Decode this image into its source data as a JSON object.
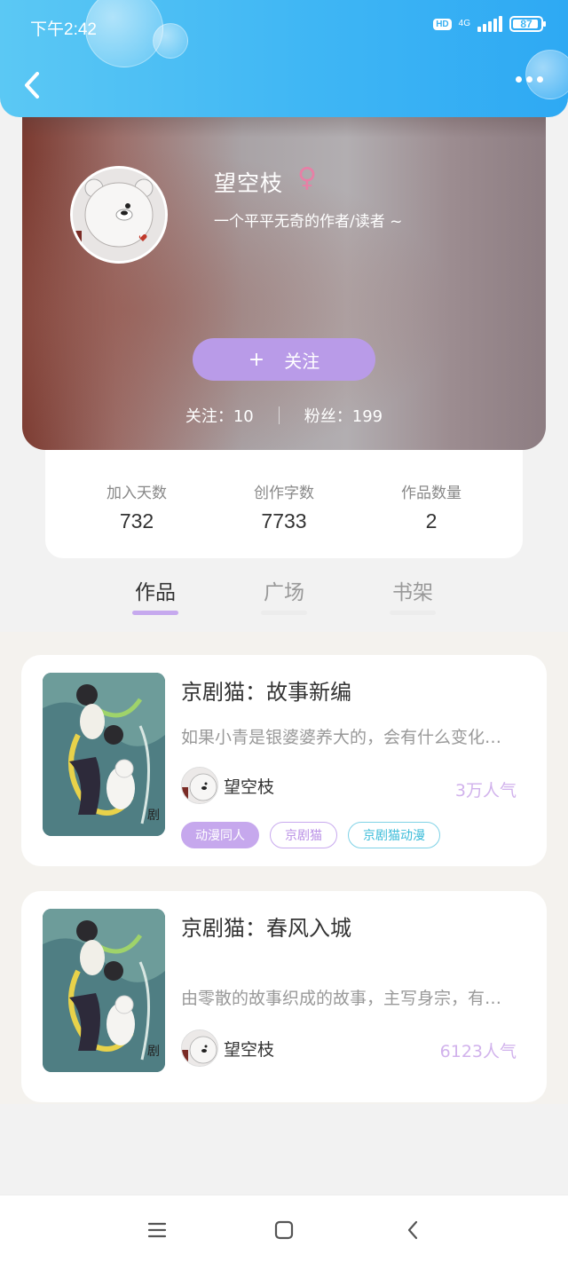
{
  "status_bar": {
    "time": "下午2:42",
    "hd": "HD",
    "network": "4G",
    "battery": "87"
  },
  "header": {
    "back_icon": "chevron-left-icon",
    "more_icon": "more-dots-icon"
  },
  "profile": {
    "username": "望空枝",
    "gender_symbol": "♀",
    "bio": "一个平平无奇的作者/读者 ~",
    "follow_plus": "+",
    "follow_label": "关注",
    "following_text": "关注：10",
    "followers_text": "粉丝：199"
  },
  "stats": [
    {
      "label": "加入天数",
      "value": "732"
    },
    {
      "label": "创作字数",
      "value": "7733"
    },
    {
      "label": "作品数量",
      "value": "2"
    }
  ],
  "tabs": [
    {
      "label": "作品",
      "active": true
    },
    {
      "label": "广场",
      "active": false
    },
    {
      "label": "书架",
      "active": false
    }
  ],
  "works": [
    {
      "title": "京剧猫：故事新编",
      "description": "如果小青是银婆婆养大的，会有什么变化…",
      "author": "望空枝",
      "popularity": "3万人气",
      "tags": [
        "动漫同人",
        "京剧猫",
        "京剧猫动漫"
      ]
    },
    {
      "title": "京剧猫：春风入城",
      "description": "由零散的故事织成的故事，主写身宗，有…",
      "author": "望空枝",
      "popularity": "6123人气",
      "tags": []
    }
  ],
  "colors": {
    "header_blue": "#3fb6f4",
    "accent_purple": "#b99be8",
    "tag_cyan": "#3cbcd9"
  }
}
